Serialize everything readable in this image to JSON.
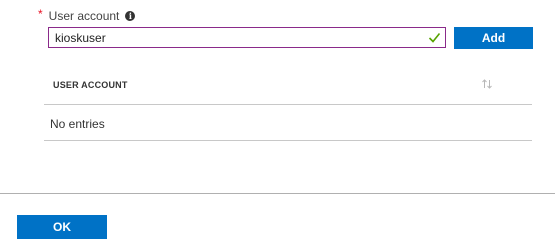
{
  "form": {
    "required_marker": "*",
    "user_account_label": "User account",
    "info_icon": "info-icon",
    "user_account_value": "kioskuser",
    "valid_icon": "checkmark-icon",
    "add_button_label": "Add"
  },
  "table": {
    "columns": [
      "USER ACCOUNT"
    ],
    "sort_icon": "sort-arrows-icon",
    "empty_text": "No entries"
  },
  "footer": {
    "ok_button_label": "OK"
  },
  "colors": {
    "primary": "#0072c6",
    "required": "#e81123",
    "valid": "#57a300",
    "input_border": "#8a2a8a"
  }
}
